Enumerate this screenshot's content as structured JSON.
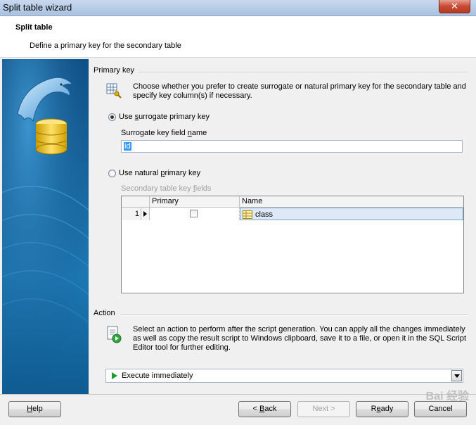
{
  "window": {
    "title": "Split table wizard",
    "close_glyph": "✕"
  },
  "header": {
    "title": "Split table",
    "subtitle": "Define a primary key for the secondary table"
  },
  "primary_key": {
    "group_label": "Primary key",
    "description": "Choose whether you prefer to create surrogate or natural primary key for the secondary table and specify key column(s) if necessary.",
    "surrogate": {
      "label_pre": "Use ",
      "label_accel": "s",
      "label_post": "urrogate primary key",
      "checked": true
    },
    "surrogate_field_label_pre": "Surrogate key field ",
    "surrogate_field_label_accel": "n",
    "surrogate_field_label_post": "ame",
    "surrogate_field_value": "id",
    "natural": {
      "label_pre": "Use natural ",
      "label_accel": "p",
      "label_post": "rimary key",
      "checked": false
    },
    "secondary_fields_label_pre": "Secondary table key ",
    "secondary_fields_label_accel": "f",
    "secondary_fields_label_post": "ields",
    "grid": {
      "columns": [
        "",
        "Primary",
        "Name"
      ],
      "rows": [
        {
          "index": "1",
          "primary": false,
          "name": "class"
        }
      ]
    }
  },
  "action": {
    "group_label": "Action",
    "description": "Select an action to perform after the script generation. You can apply all the changes immediately as well as copy the result script to Windows clipboard, save it to a file, or open it in the SQL Script Editor tool for further editing.",
    "selected": "Execute immediately"
  },
  "buttons": {
    "help_accel": "H",
    "help_rest": "elp",
    "back_prefix": "< ",
    "back_accel": "B",
    "back_rest": "ack",
    "next": "Next >",
    "ready_pre": "R",
    "ready_accel": "e",
    "ready_rest": "ady",
    "cancel": "Cancel"
  },
  "watermark": "Bai 经验"
}
